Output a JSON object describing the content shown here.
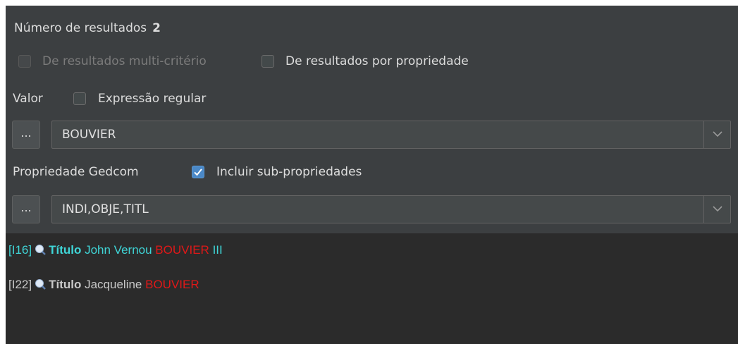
{
  "header": {
    "results_label": "Número de resultados",
    "results_count": "2"
  },
  "options": {
    "multi_criteria_label": "De resultados multi-critério",
    "by_property_label": "De resultados por propriedade"
  },
  "value_section": {
    "label": "Valor",
    "regex_label": "Expressão regular",
    "dots_label": "...",
    "value": "BOUVIER"
  },
  "property_section": {
    "label": "Propriedade Gedcom",
    "include_sub_label": "Incluir sub-propriedades",
    "dots_label": "...",
    "value": "INDI,OBJE,TITL"
  },
  "results": [
    {
      "id": "[I16]",
      "tag": "Título",
      "text": "John Vernou",
      "highlight": "BOUVIER",
      "suffix": "III"
    },
    {
      "id": "[I22]",
      "tag": "Título",
      "text": "Jacqueline",
      "highlight": "BOUVIER",
      "suffix": ""
    }
  ],
  "colors": {
    "background": "#3c3f41",
    "results_background": "#2b2b2b",
    "selected_text": "#3fd5d7",
    "highlight": "#e01818",
    "checkbox_checked": "#4a88c7"
  }
}
